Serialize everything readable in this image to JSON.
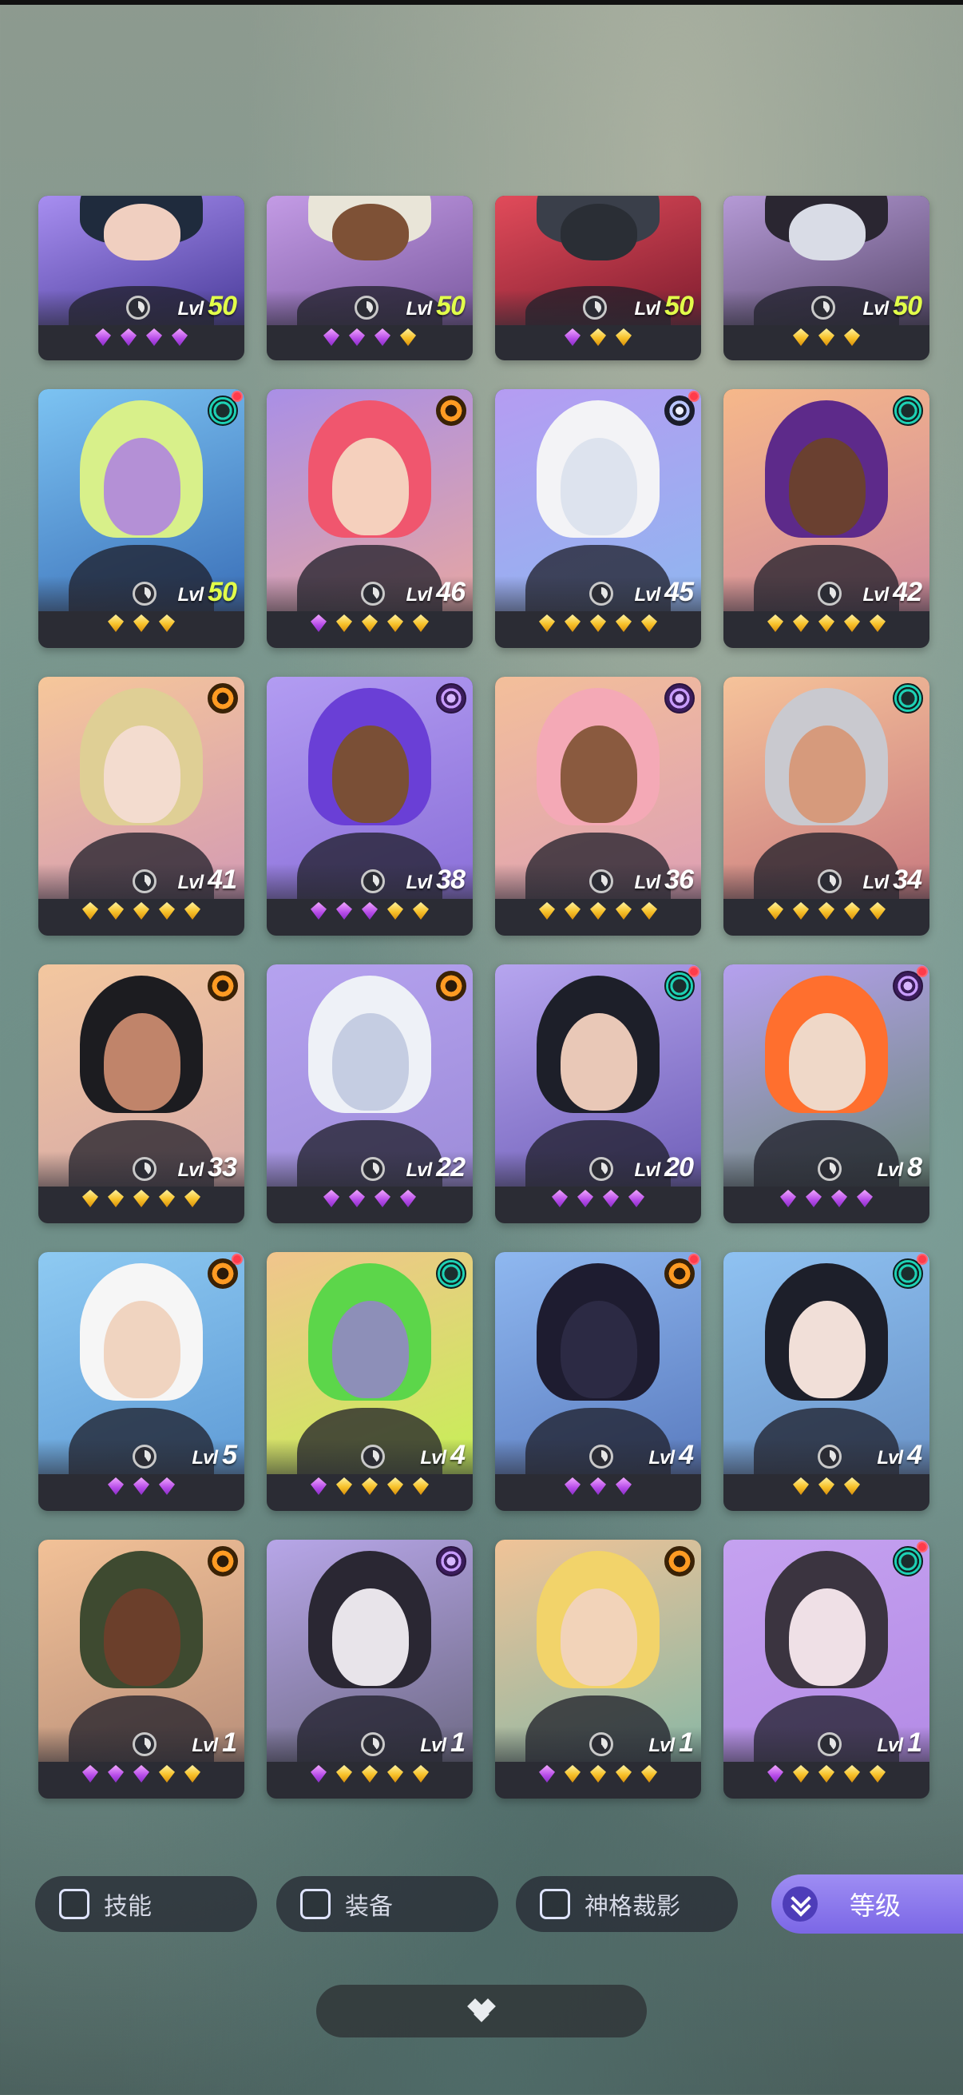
{
  "cards": [
    {
      "level": "50",
      "max": true,
      "gems": [
        "p",
        "p",
        "p",
        "p"
      ],
      "emblem": null,
      "dot": false,
      "bg": [
        "#a78ef0",
        "#4a3c9a"
      ],
      "skin": "#f0cfc0",
      "hair": "#1f2b3d"
    },
    {
      "level": "50",
      "max": true,
      "gems": [
        "p",
        "p",
        "p",
        "y"
      ],
      "emblem": null,
      "dot": false,
      "bg": [
        "#c39be5",
        "#7b5aa0"
      ],
      "skin": "#7e5136",
      "hair": "#e9e5d8"
    },
    {
      "level": "50",
      "max": true,
      "gems": [
        "p",
        "y",
        "y"
      ],
      "emblem": null,
      "dot": false,
      "bg": [
        "#e14b5a",
        "#7f1d2f"
      ],
      "skin": "#2a2e35",
      "hair": "#3a3f4a"
    },
    {
      "level": "50",
      "max": true,
      "gems": [
        "y",
        "y",
        "y"
      ],
      "emblem": null,
      "dot": false,
      "bg": [
        "#b59ad6",
        "#5a4a6e"
      ],
      "skin": "#d9dce6",
      "hair": "#2a2631"
    },
    {
      "level": "50",
      "max": true,
      "gems": [
        "y",
        "y",
        "y"
      ],
      "emblem": "teal",
      "dot": true,
      "bg": [
        "#7cc3f2",
        "#3a6fb8"
      ],
      "skin": "#b490d6",
      "hair": "#d8f08a"
    },
    {
      "level": "46",
      "max": false,
      "gems": [
        "p",
        "y",
        "y",
        "y",
        "y"
      ],
      "emblem": "orange",
      "dot": false,
      "bg": [
        "#a98fe6",
        "#e6a6a2"
      ],
      "skin": "#f5d0bd",
      "hair": "#f0566e"
    },
    {
      "level": "45",
      "max": false,
      "gems": [
        "y",
        "y",
        "y",
        "y",
        "y"
      ],
      "emblem": "steel",
      "dot": true,
      "bg": [
        "#b59cf2",
        "#8fb6f0"
      ],
      "skin": "#dde3ee",
      "hair": "#f3f3f6"
    },
    {
      "level": "42",
      "max": false,
      "gems": [
        "y",
        "y",
        "y",
        "y",
        "y"
      ],
      "emblem": "teal",
      "dot": false,
      "bg": [
        "#f6b88a",
        "#d08a9c"
      ],
      "skin": "#6a4030",
      "hair": "#5d2a8a"
    },
    {
      "level": "41",
      "max": false,
      "gems": [
        "y",
        "y",
        "y",
        "y",
        "y"
      ],
      "emblem": "orange",
      "dot": false,
      "bg": [
        "#f6c79a",
        "#d39ab3"
      ],
      "skin": "#f3dccf",
      "hair": "#dfcf95"
    },
    {
      "level": "38",
      "max": false,
      "gems": [
        "p",
        "p",
        "p",
        "y",
        "y"
      ],
      "emblem": "purple",
      "dot": false,
      "bg": [
        "#b29cf2",
        "#8a6fd8"
      ],
      "skin": "#7a4f36",
      "hair": "#6a3fd6"
    },
    {
      "level": "36",
      "max": false,
      "gems": [
        "y",
        "y",
        "y",
        "y",
        "y"
      ],
      "emblem": "purple",
      "dot": false,
      "bg": [
        "#f3bf9a",
        "#dd9fb4"
      ],
      "skin": "#8a5a3f",
      "hair": "#f4a9b6"
    },
    {
      "level": "34",
      "max": false,
      "gems": [
        "y",
        "y",
        "y",
        "y",
        "y"
      ],
      "emblem": "teal",
      "dot": false,
      "bg": [
        "#f6c39a",
        "#c8797f"
      ],
      "skin": "#d69a7c",
      "hair": "#c9c9cf"
    },
    {
      "level": "33",
      "max": false,
      "gems": [
        "y",
        "y",
        "y",
        "y",
        "y"
      ],
      "emblem": "orange",
      "dot": false,
      "bg": [
        "#f3c79f",
        "#d6a9a7"
      ],
      "skin": "#c0846a",
      "hair": "#1c1c20"
    },
    {
      "level": "22",
      "max": false,
      "gems": [
        "p",
        "p",
        "p",
        "p"
      ],
      "emblem": "orange",
      "dot": false,
      "bg": [
        "#b5a2ef",
        "#9d8cd9"
      ],
      "skin": "#c5cde2",
      "hair": "#eef1f7"
    },
    {
      "level": "20",
      "max": false,
      "gems": [
        "p",
        "p",
        "p",
        "p"
      ],
      "emblem": "teal",
      "dot": true,
      "bg": [
        "#b6a5ef",
        "#6f5fb8"
      ],
      "skin": "#e9c8b7",
      "hair": "#1d1f29"
    },
    {
      "level": "8",
      "max": false,
      "gems": [
        "p",
        "p",
        "p",
        "p"
      ],
      "emblem": "purple",
      "dot": true,
      "bg": [
        "#b5a0ef",
        "#6d8a7a"
      ],
      "skin": "#efd8c8",
      "hair": "#ff6f2e"
    },
    {
      "level": "5",
      "max": false,
      "gems": [
        "p",
        "p",
        "p"
      ],
      "emblem": "orange",
      "dot": true,
      "bg": [
        "#8ecaf2",
        "#5f9bd6"
      ],
      "skin": "#f0d4c0",
      "hair": "#f6f6f6"
    },
    {
      "level": "4",
      "max": false,
      "gems": [
        "p",
        "y",
        "y",
        "y",
        "y"
      ],
      "emblem": "teal",
      "dot": false,
      "bg": [
        "#f1c48d",
        "#c6f055"
      ],
      "skin": "#8d8fb8",
      "hair": "#5cd64a"
    },
    {
      "level": "4",
      "max": false,
      "gems": [
        "p",
        "p",
        "p"
      ],
      "emblem": "orange",
      "dot": true,
      "bg": [
        "#8fb8f0",
        "#5a7bbf"
      ],
      "skin": "#2c2a44",
      "hair": "#1e1c30"
    },
    {
      "level": "4",
      "max": false,
      "gems": [
        "y",
        "y",
        "y"
      ],
      "emblem": "teal",
      "dot": true,
      "bg": [
        "#8fc2f2",
        "#6a93c8"
      ],
      "skin": "#f1dfd8",
      "hair": "#1d1f2a"
    },
    {
      "level": "1",
      "max": false,
      "gems": [
        "p",
        "p",
        "p",
        "y",
        "y"
      ],
      "emblem": "orange",
      "dot": false,
      "bg": [
        "#f2c197",
        "#b98f7a"
      ],
      "skin": "#6b3f2b",
      "hair": "#3e4a30"
    },
    {
      "level": "1",
      "max": false,
      "gems": [
        "p",
        "y",
        "y",
        "y",
        "y"
      ],
      "emblem": "purple",
      "dot": false,
      "bg": [
        "#b7a6e8",
        "#6e6a85"
      ],
      "skin": "#e8e4ea",
      "hair": "#2a2733"
    },
    {
      "level": "1",
      "max": false,
      "gems": [
        "p",
        "y",
        "y",
        "y",
        "y"
      ],
      "emblem": "orange",
      "dot": false,
      "bg": [
        "#f0c397",
        "#89b7a5"
      ],
      "skin": "#f2d3b9",
      "hair": "#f2d36a"
    },
    {
      "level": "1",
      "max": false,
      "gems": [
        "p",
        "y",
        "y",
        "y",
        "y"
      ],
      "emblem": "teal",
      "dot": true,
      "bg": [
        "#c5a2f0",
        "#b48be6"
      ],
      "skin": "#efe0e6",
      "hair": "#3b3440"
    }
  ],
  "level_prefix": "Lvl",
  "filters": [
    {
      "label": "技能"
    },
    {
      "label": "装备"
    },
    {
      "label": "神格裁影"
    }
  ],
  "sort": {
    "label": "等级"
  }
}
